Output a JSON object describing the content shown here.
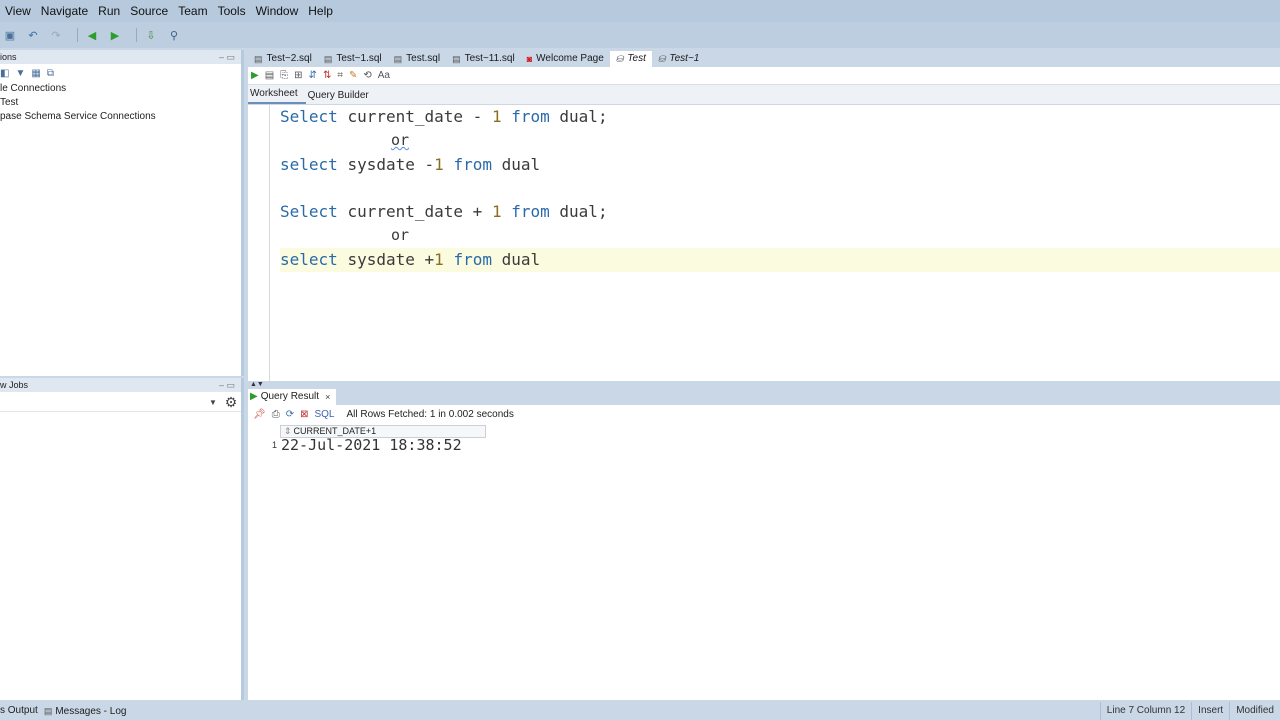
{
  "menu": {
    "items": [
      "View",
      "Navigate",
      "Run",
      "Source",
      "Team",
      "Tools",
      "Window",
      "Help"
    ]
  },
  "left_panel": {
    "title": "ions",
    "tree": [
      "le Connections",
      "Test",
      "pase Schema Service Connections"
    ],
    "jobs_title": "w Jobs"
  },
  "tabs": [
    {
      "label": "Test~2.sql",
      "icon": "sql-file-icon"
    },
    {
      "label": "Test~1.sql",
      "icon": "sql-file-icon"
    },
    {
      "label": "Test.sql",
      "icon": "sql-file-icon"
    },
    {
      "label": "Test~11.sql",
      "icon": "sql-file-icon"
    },
    {
      "label": "Welcome Page",
      "icon": "oracle-icon"
    },
    {
      "label": "Test",
      "icon": "db-connection-icon"
    },
    {
      "label": "Test~1",
      "icon": "db-connection-icon"
    }
  ],
  "active_tab": "Test",
  "subtabs": {
    "worksheet": "Worksheet",
    "query_builder": "Query Builder"
  },
  "code": {
    "l1": {
      "kw1": "Select",
      "mid": "current_date",
      "op": "-",
      "num": "1",
      "kw2": "from",
      "tail": "dual;"
    },
    "l2": {
      "text": "or"
    },
    "l3": {
      "kw1": "select",
      "mid": "sysdate",
      "op": "-",
      "num": "1",
      "kw2": "from",
      "tail": "dual"
    },
    "l5": {
      "kw1": "Select",
      "mid": "current_date",
      "op": "+",
      "num": "1",
      "kw2": "from",
      "tail": "dual;"
    },
    "l6": {
      "text": "or"
    },
    "l7": {
      "kw1": "select",
      "mid": "sysdate",
      "op": "+",
      "num": "1",
      "kw2": "from",
      "tail": "dual"
    }
  },
  "result": {
    "tab_label": "Query Result",
    "sql_label": "SQL",
    "status": "All Rows Fetched: 1 in 0.002 seconds",
    "column": "CURRENT_DATE+1",
    "rownum": "1",
    "value": "22-Jul-2021 18:38:52"
  },
  "statusbar": {
    "left": [
      "s Output",
      "Messages - Log"
    ],
    "position": "Line 7 Column 12",
    "mode": "Insert",
    "state": "Modified"
  },
  "colors": {
    "keyword": "#2a6aa8",
    "number": "#8a6d1f",
    "current_line": "#fbfbe0",
    "chrome": "#c9d7e6"
  }
}
